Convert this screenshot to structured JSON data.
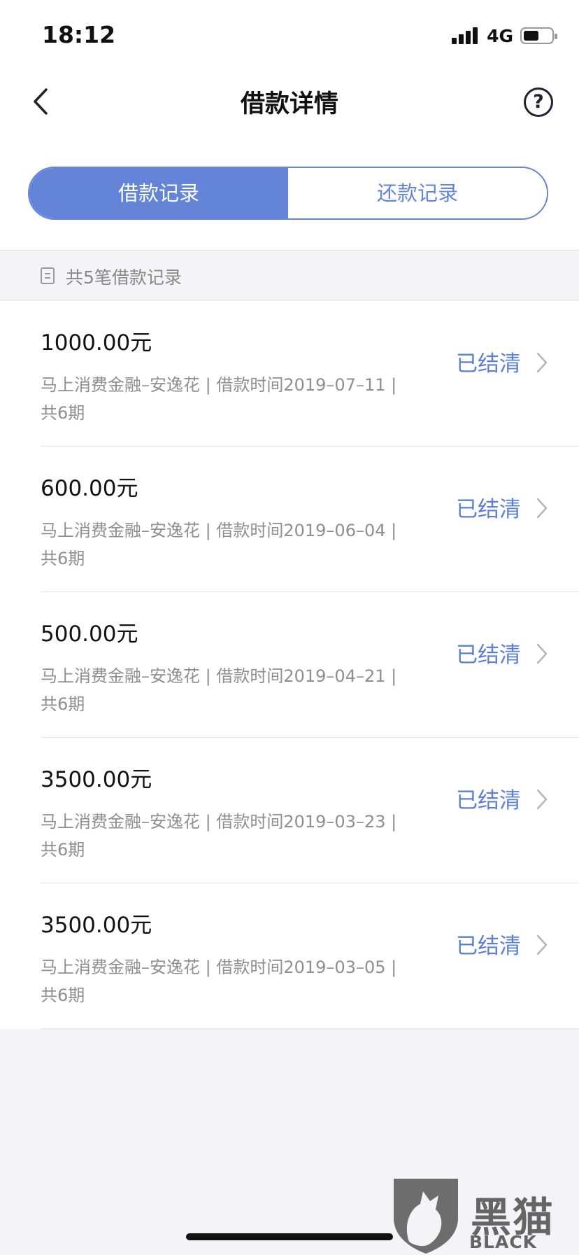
{
  "status_bar": {
    "time": "18:12",
    "network": "4G",
    "battery_level": 0.55
  },
  "header": {
    "title": "借款详情",
    "back_icon": "chevron-left-icon",
    "help_icon": "question-circle-icon",
    "help_symbol": "?"
  },
  "tabs": [
    {
      "label": "借款记录",
      "active": true
    },
    {
      "label": "还款记录",
      "active": false
    }
  ],
  "summary": {
    "text": "共5笔借款记录",
    "icon": "document-icon"
  },
  "records": [
    {
      "amount": "1000.00元",
      "desc": "马上消费金融–安逸花 | 借款时间2019–07–11 |",
      "periods": "共6期",
      "status": "已结清"
    },
    {
      "amount": "600.00元",
      "desc": "马上消费金融–安逸花 | 借款时间2019–06–04 |",
      "periods": "共6期",
      "status": "已结清"
    },
    {
      "amount": "500.00元",
      "desc": "马上消费金融–安逸花 | 借款时间2019–04–21 |",
      "periods": "共6期",
      "status": "已结清"
    },
    {
      "amount": "3500.00元",
      "desc": "马上消费金融–安逸花 | 借款时间2019–03–23 |",
      "periods": "共6期",
      "status": "已结清"
    },
    {
      "amount": "3500.00元",
      "desc": "马上消费金融–安逸花 | 借款时间2019–03–05 |",
      "periods": "共6期",
      "status": "已结清"
    }
  ],
  "watermark": {
    "name": "黑猫",
    "sub": "BLACK CAT"
  },
  "colors": {
    "accent": "#6484d8",
    "status_text": "#5b7fd6",
    "muted": "#8e8e93",
    "background": "#f4f4f6"
  }
}
